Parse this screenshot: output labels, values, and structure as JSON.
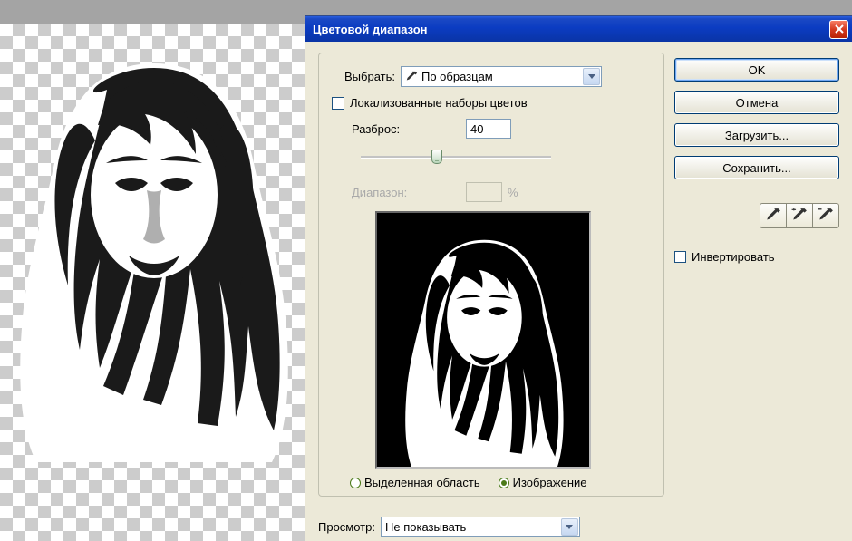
{
  "dialog": {
    "title": "Цветовой диапазон",
    "select_label": "Выбрать:",
    "select_value": "По образцам",
    "localized_checkbox": "Локализованные наборы цветов",
    "fuzziness_label": "Разброс:",
    "fuzziness_value": "40",
    "range_label": "Диапазон:",
    "range_unit": "%",
    "radio_selection": "Выделенная область",
    "radio_image": "Изображение",
    "preview_label": "Просмотр:",
    "preview_value": "Не показывать"
  },
  "buttons": {
    "ok": "OK",
    "cancel": "Отмена",
    "load": "Загрузить...",
    "save": "Сохранить..."
  },
  "invert_label": "Инвертировать"
}
